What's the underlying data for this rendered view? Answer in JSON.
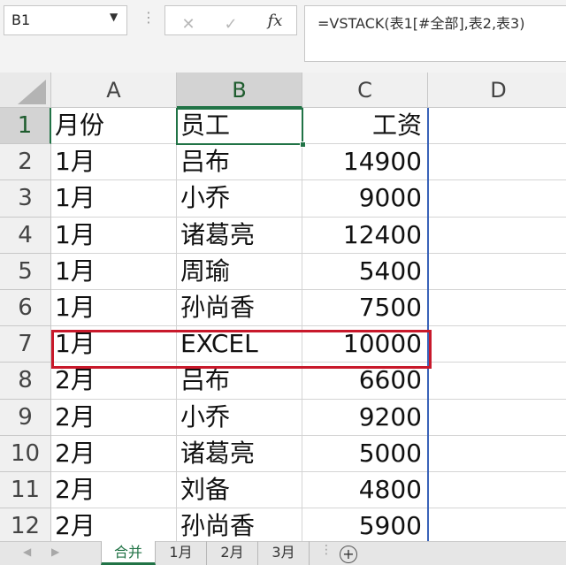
{
  "formula_bar": {
    "name_box": "B1",
    "cancel_glyph": "✕",
    "enter_glyph": "✓",
    "fx_label": "fx",
    "formula": "=VSTACK(表1[#全部],表2,表3)"
  },
  "columns": [
    "A",
    "B",
    "C",
    "D"
  ],
  "rows": [
    {
      "n": "1",
      "a": "月份",
      "b": "员工",
      "c": "工资"
    },
    {
      "n": "2",
      "a": "1月",
      "b": "吕布",
      "c": "14900"
    },
    {
      "n": "3",
      "a": "1月",
      "b": "小乔",
      "c": "9000"
    },
    {
      "n": "4",
      "a": "1月",
      "b": "诸葛亮",
      "c": "12400"
    },
    {
      "n": "5",
      "a": "1月",
      "b": "周瑜",
      "c": "5400"
    },
    {
      "n": "6",
      "a": "1月",
      "b": "孙尚香",
      "c": "7500"
    },
    {
      "n": "7",
      "a": "1月",
      "b": "EXCEL",
      "c": "10000"
    },
    {
      "n": "8",
      "a": "2月",
      "b": "吕布",
      "c": "6600"
    },
    {
      "n": "9",
      "a": "2月",
      "b": "小乔",
      "c": "9200"
    },
    {
      "n": "10",
      "a": "2月",
      "b": "诸葛亮",
      "c": "5000"
    },
    {
      "n": "11",
      "a": "2月",
      "b": "刘备",
      "c": "4800"
    },
    {
      "n": "12",
      "a": "2月",
      "b": "孙尚香",
      "c": "5900"
    }
  ],
  "sheet_tabs": [
    "合并",
    "1月",
    "2月",
    "3月"
  ],
  "active_tab": "合并",
  "add_sheet_glyph": "+",
  "accent_color": "#217346",
  "highlight_color": "#c8192b"
}
